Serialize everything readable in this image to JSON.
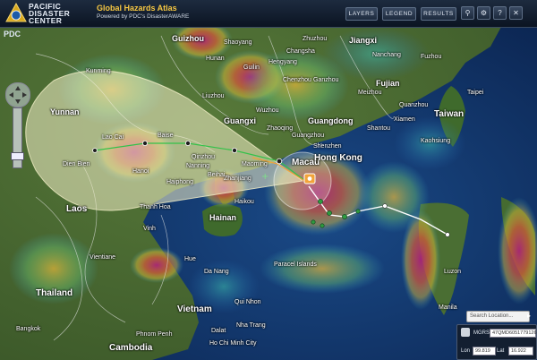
{
  "app": {
    "logo_text": [
      "PACIFIC",
      "DISASTER",
      "CENTER"
    ],
    "title": "Global Hazards Atlas",
    "subtitle": "Powered by PDC's DisasterAWARE",
    "mini_logo": "PDC"
  },
  "toolbar": {
    "layers_label": "LAYERS",
    "legend_label": "LEGEND",
    "results_label": "RESULTS",
    "icons": [
      "search-icon",
      "settings-icon",
      "help-icon",
      "close-icon"
    ]
  },
  "map": {
    "places_large": [
      "Taiwan",
      "Laos",
      "Thailand",
      "Vietnam",
      "Cambodia",
      "Hong Kong",
      "Hainan"
    ],
    "places_medium": [
      "Yunnan",
      "Guangxi",
      "Guangdong",
      "Fujian",
      "Jiangxi",
      "Guizhou",
      "Macau"
    ],
    "places_small": [
      "Hunan",
      "Changsha",
      "Nanning",
      "Shenzhen",
      "Guangzhou",
      "Zhanjiang",
      "Haiphong",
      "Hanoi",
      "Kunming",
      "Xiamen",
      "Quanzhou",
      "Taipei",
      "Kaohsiung",
      "Fuzhou",
      "Nanchang",
      "Ganzhou",
      "Vientiane",
      "Bangkok",
      "Phnom Penh",
      "Da Nang",
      "Haikou",
      "Paracel Islands",
      "Manila",
      "Luzon",
      "Ho Chi Minh City",
      "Meizhou",
      "Shantou",
      "Liuzhou",
      "Guilin",
      "Wuzhou",
      "Zhuzhou",
      "Shaoyang",
      "Hengyang",
      "Chenzhou",
      "Zhaoqing",
      "Maoming",
      "Beihai",
      "Qinzhou",
      "Baise",
      "Lao Cai",
      "Dien Bien",
      "Thanh Hoa",
      "Vinh",
      "Hue",
      "Qui Nhon",
      "Nha Trang",
      "Dalat"
    ]
  },
  "search": {
    "placeholder": "Search Location..."
  },
  "coords": {
    "mgrs_label": "MGRS",
    "mgrs_value": "47QMD6051779126",
    "lon_label": "Lon",
    "lon_value": "99.819",
    "lat_label": "Lat",
    "lat_value": "16.922"
  },
  "colors": {
    "accent": "#f6c742",
    "track_green": "#33c24a",
    "track_white": "#ffffff",
    "storm_orange": "#f2a33a",
    "cone_fill": "#f4f0c8"
  }
}
